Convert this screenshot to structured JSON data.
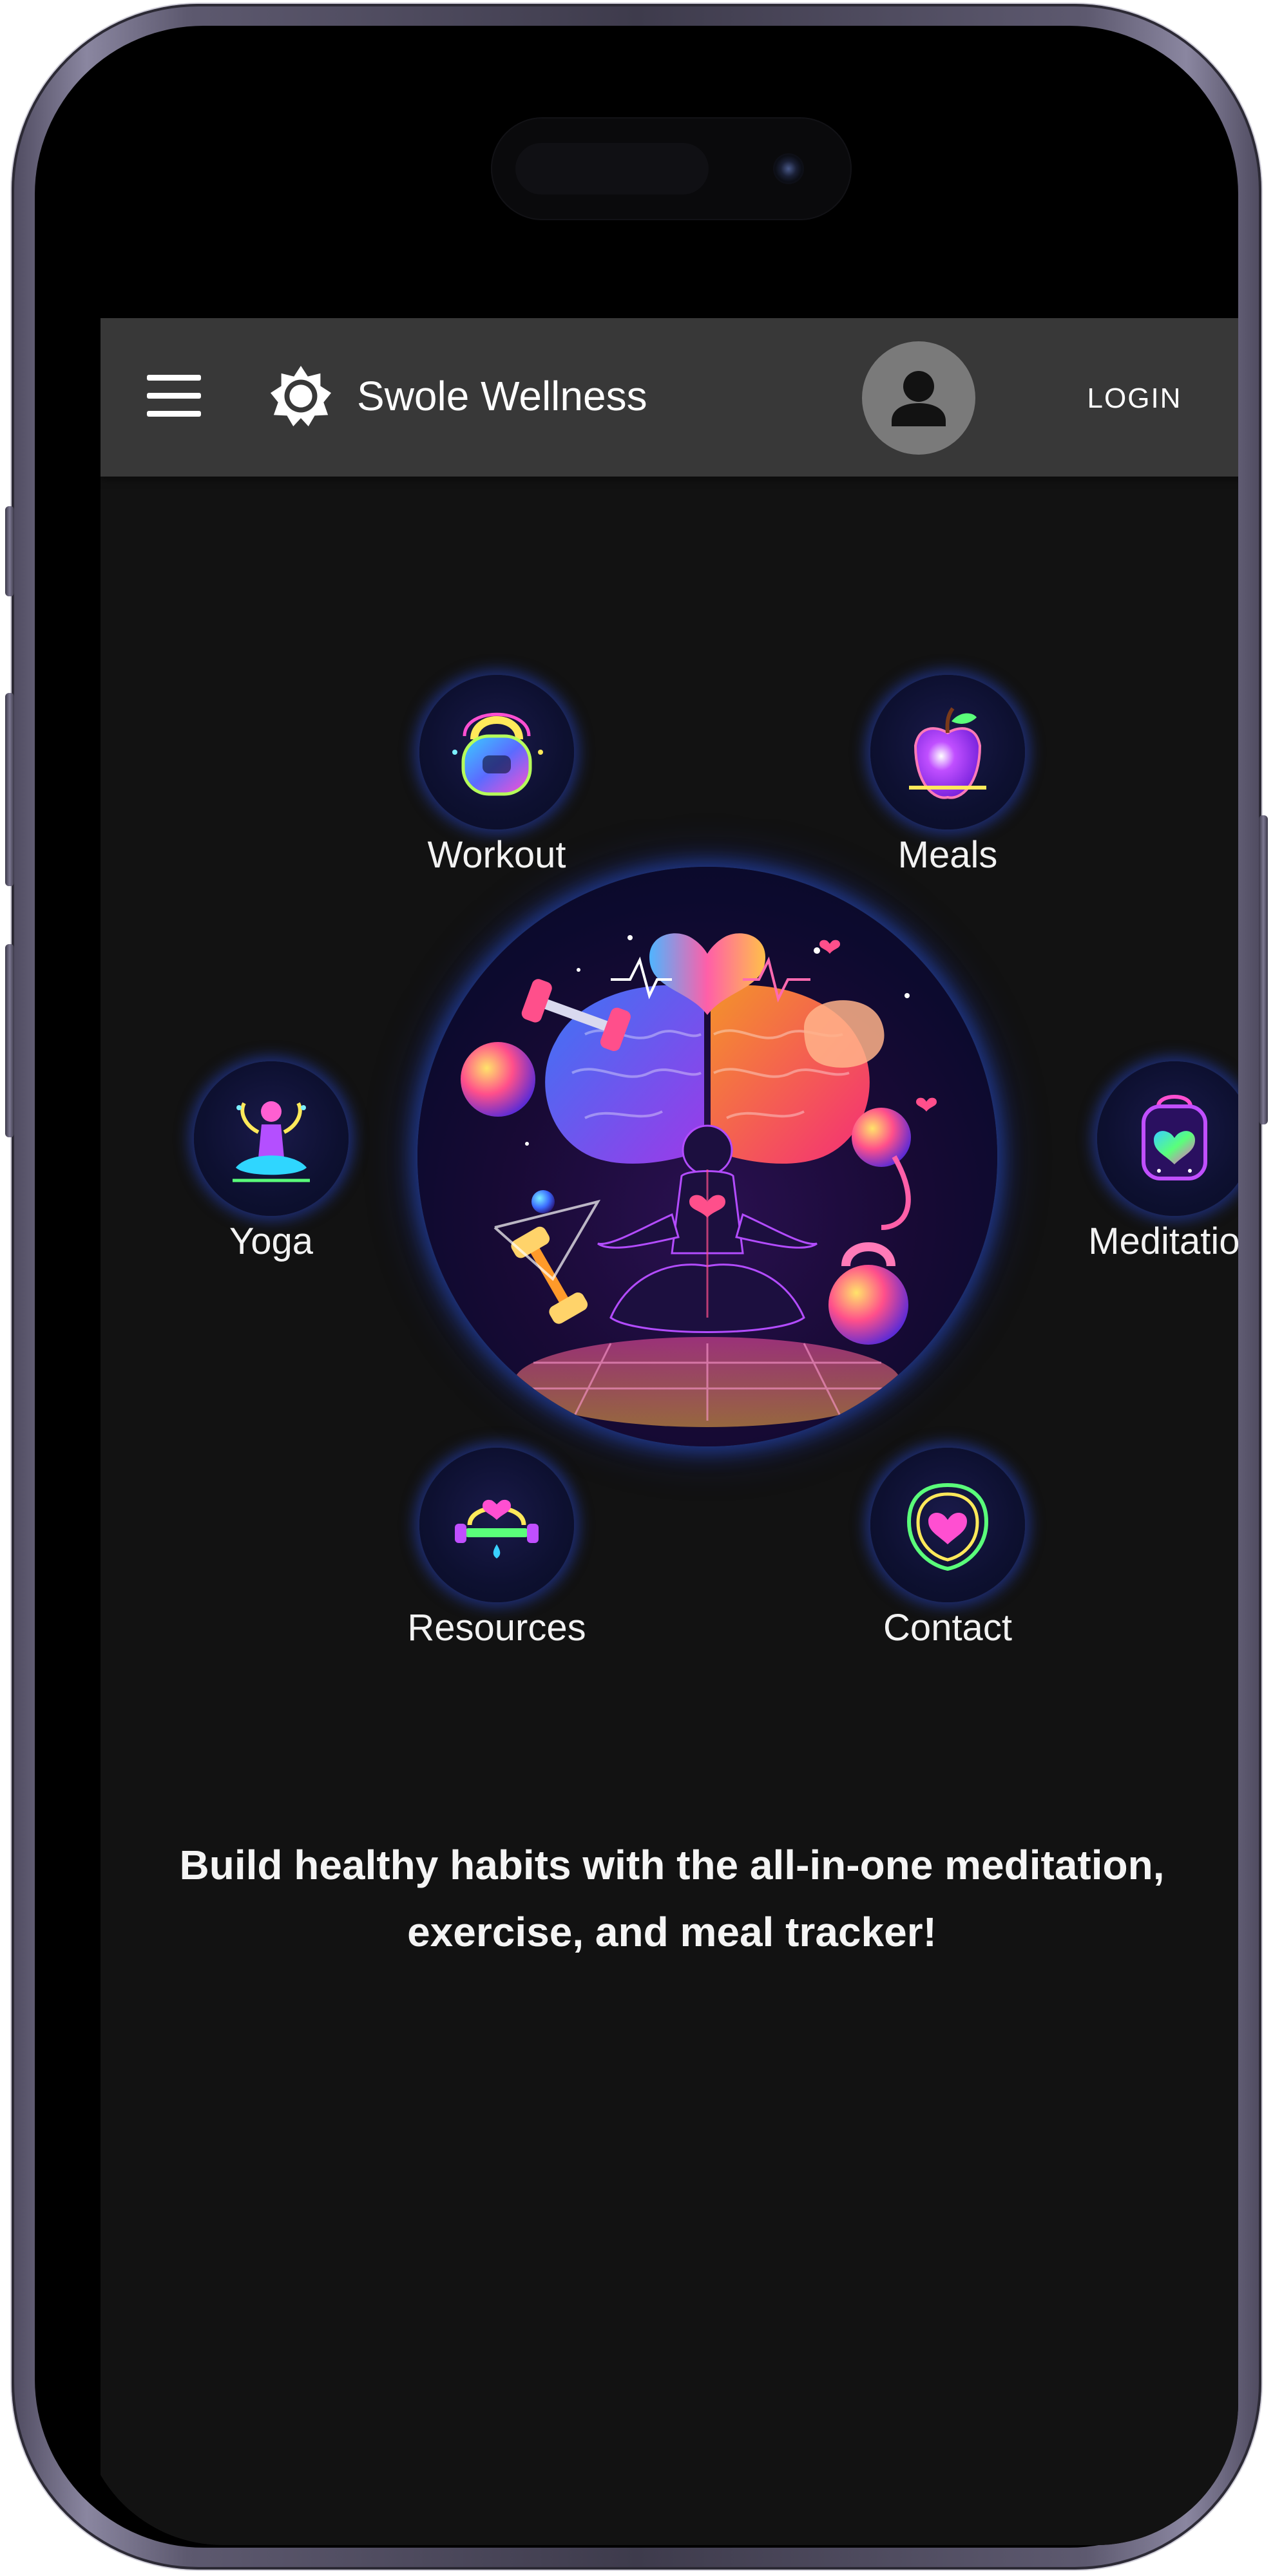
{
  "appbar": {
    "title": "Swole Wellness",
    "login_label": "LOGIN",
    "menu_icon": "menu-icon",
    "logo_icon": "gear-icon",
    "avatar_icon": "person-icon"
  },
  "features": [
    {
      "label": "Workout",
      "icon": "kettlebell-icon"
    },
    {
      "label": "Meals",
      "icon": "apple-icon"
    },
    {
      "label": "Yoga",
      "icon": "yoga-pose-icon"
    },
    {
      "label": "Meditation",
      "icon": "heart-jar-icon"
    },
    {
      "label": "Resources",
      "icon": "heart-scale-icon"
    },
    {
      "label": "Contact",
      "icon": "heart-badge-icon"
    }
  ],
  "hero": {
    "icon": "wellness-illustration"
  },
  "tagline": "Build healthy habits with the all-in-one meditation, exercise, and meal tracker!",
  "colors": {
    "appbar": "#383838",
    "background": "#121212",
    "avatar": "#7a7a7a",
    "glow": "#2a4bd0"
  }
}
